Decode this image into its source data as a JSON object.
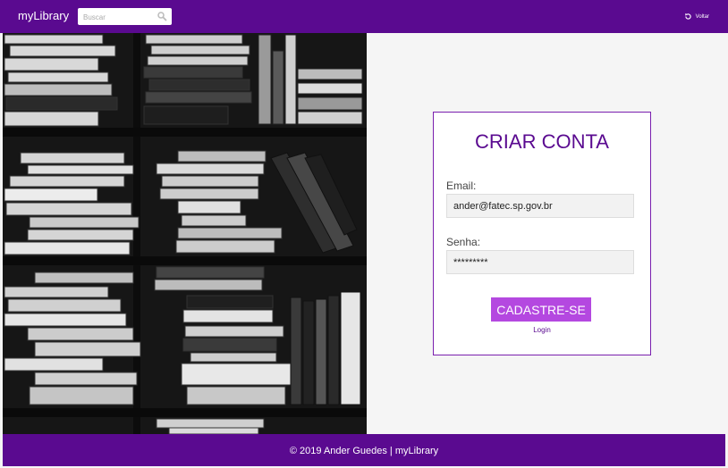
{
  "header": {
    "brand": "myLibrary",
    "search_placeholder": "Buscar",
    "back_label": "Voltar",
    "icons": {
      "search": "search-icon",
      "back": "refresh-icon"
    }
  },
  "signup": {
    "title": "CRIAR CONTA",
    "email_label": "Email:",
    "email_value": "ander@fatec.sp.gov.br",
    "password_label": "Senha:",
    "password_value": "*********",
    "submit_label": "CADASTRE-SE",
    "login_link": "Login"
  },
  "footer": {
    "text": "© 2019 Ander Guedes | myLibrary"
  },
  "colors": {
    "primary": "#5a0a90",
    "button": "#b448e0",
    "background": "#f5f5f5"
  }
}
